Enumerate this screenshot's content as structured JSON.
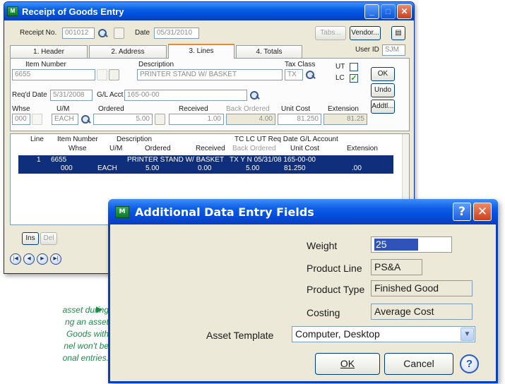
{
  "caption": {
    "lines": [
      "asset during",
      "ng an asset",
      "Goods with",
      "nel won't be",
      "onal entries."
    ],
    "arrow": "▶",
    "color": "#1f8a4a"
  },
  "main_window": {
    "title": "Receipt of Goods Entry",
    "icon_text": "M",
    "receipt_label": "Receipt No.",
    "receipt_no": "001012",
    "date_label": "Date",
    "date_value": "05/31/2010",
    "tabs_button": "Tabs...",
    "vendor_button": "Vendor...",
    "user_id_label": "User ID",
    "user_id_value": "SJM",
    "tabs": [
      "1. Header",
      "2. Address",
      "3. Lines",
      "4. Totals"
    ],
    "active_tab": "3. Lines",
    "lines": {
      "item_number_label": "Item Number",
      "item_number": "6655",
      "description_label": "Description",
      "description": "PRINTER STAND W/ BASKET",
      "tax_class_label": "Tax Class",
      "tax_class": "TX",
      "ut_label": "UT",
      "lc_label": "LC",
      "ut_checked": false,
      "lc_checked": true,
      "ok_button": "OK",
      "undo_button": "Undo",
      "addtl_button": "Addtl...",
      "reqd_date_label": "Req'd Date",
      "reqd_date": "5/31/2008",
      "gl_acct_label": "G/L Acct",
      "gl_acct": "165-00-00",
      "whse_label": "Whse",
      "whse": "000",
      "um_label": "U/M",
      "um": "EACH",
      "ordered_label": "Ordered",
      "ordered": "5.00",
      "received_label": "Received",
      "received": "1.00",
      "back_ordered_label": "Back Ordered",
      "back_ordered": "4.00",
      "unit_cost_label": "Unit Cost",
      "unit_cost": "81.250",
      "extension_label": "Extension",
      "extension": "81.25"
    },
    "grid": {
      "headers_row1": {
        "line": "Line",
        "item": "Item Number",
        "desc": "Description",
        "flags": "TC LC UT Req Date  G/L Account"
      },
      "headers_row2": {
        "whse": "Whse",
        "um": "U/M",
        "ordered": "Ordered",
        "received": "Received",
        "back_ordered": "Back Ordered",
        "unit_cost": "Unit Cost",
        "extension": "Extension"
      },
      "row": {
        "line": "1",
        "item": "6655",
        "desc": "PRINTER STAND W/ BASKET",
        "flags": "TX  Y  N  05/31/08  165-00-00",
        "whse": "000",
        "um": "EACH",
        "ordered": "5.00",
        "received": "0.00",
        "back_ordered": "5.00",
        "unit_cost": "81.250",
        "extension": ".00"
      }
    },
    "ins_button": "Ins",
    "del_button": "Del",
    "nav_icons": [
      "first-icon",
      "prev-icon",
      "next-icon",
      "last-icon"
    ]
  },
  "dialog": {
    "title": "Additional Data Entry Fields",
    "icon_text": "M",
    "help_glyph": "?",
    "close_glyph": "✕",
    "weight_label": "Weight",
    "weight_value": "25",
    "product_line_label": "Product Line",
    "product_line_value": "PS&A",
    "product_type_label": "Product Type",
    "product_type_value": "Finished Good",
    "costing_label": "Costing",
    "costing_value": "Average Cost",
    "asset_template_label": "Asset Template",
    "asset_template_value": "Computer, Desktop",
    "ok_button": "OK",
    "cancel_button": "Cancel"
  }
}
